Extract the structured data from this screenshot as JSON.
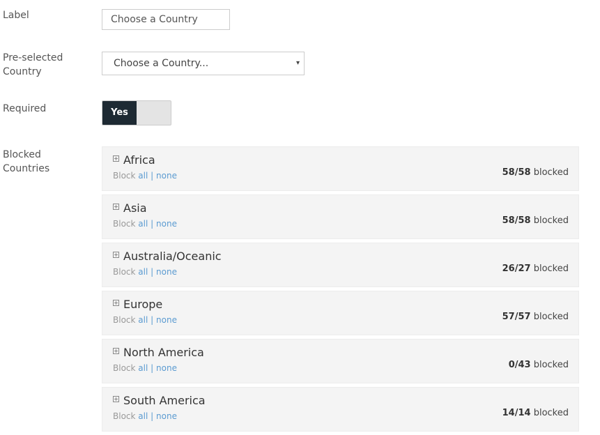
{
  "form": {
    "label": {
      "title": "Label",
      "placeholder": "Choose a Country"
    },
    "preselected": {
      "title_line1": "Pre-selected",
      "title_line2": "Country",
      "value": "Choose a Country...",
      "arrow": "▾"
    },
    "required": {
      "title": "Required",
      "toggle_label": "Yes",
      "value": true
    },
    "blocked": {
      "title_line1": "Blocked",
      "title_line2": "Countries"
    }
  },
  "block_text": {
    "prefix": "Block",
    "all": "all",
    "separator": "|",
    "none": "none",
    "suffix": "blocked"
  },
  "regions": [
    {
      "name": "Africa",
      "count": "58/58"
    },
    {
      "name": "Asia",
      "count": "58/58"
    },
    {
      "name": "Australia/Oceanic",
      "count": "26/27"
    },
    {
      "name": "Europe",
      "count": "57/57"
    },
    {
      "name": "North America",
      "count": "0/43"
    },
    {
      "name": "South America",
      "count": "14/14"
    }
  ],
  "icons": {
    "expand": "plus-square-icon",
    "dropdown": "caret-down-icon"
  }
}
